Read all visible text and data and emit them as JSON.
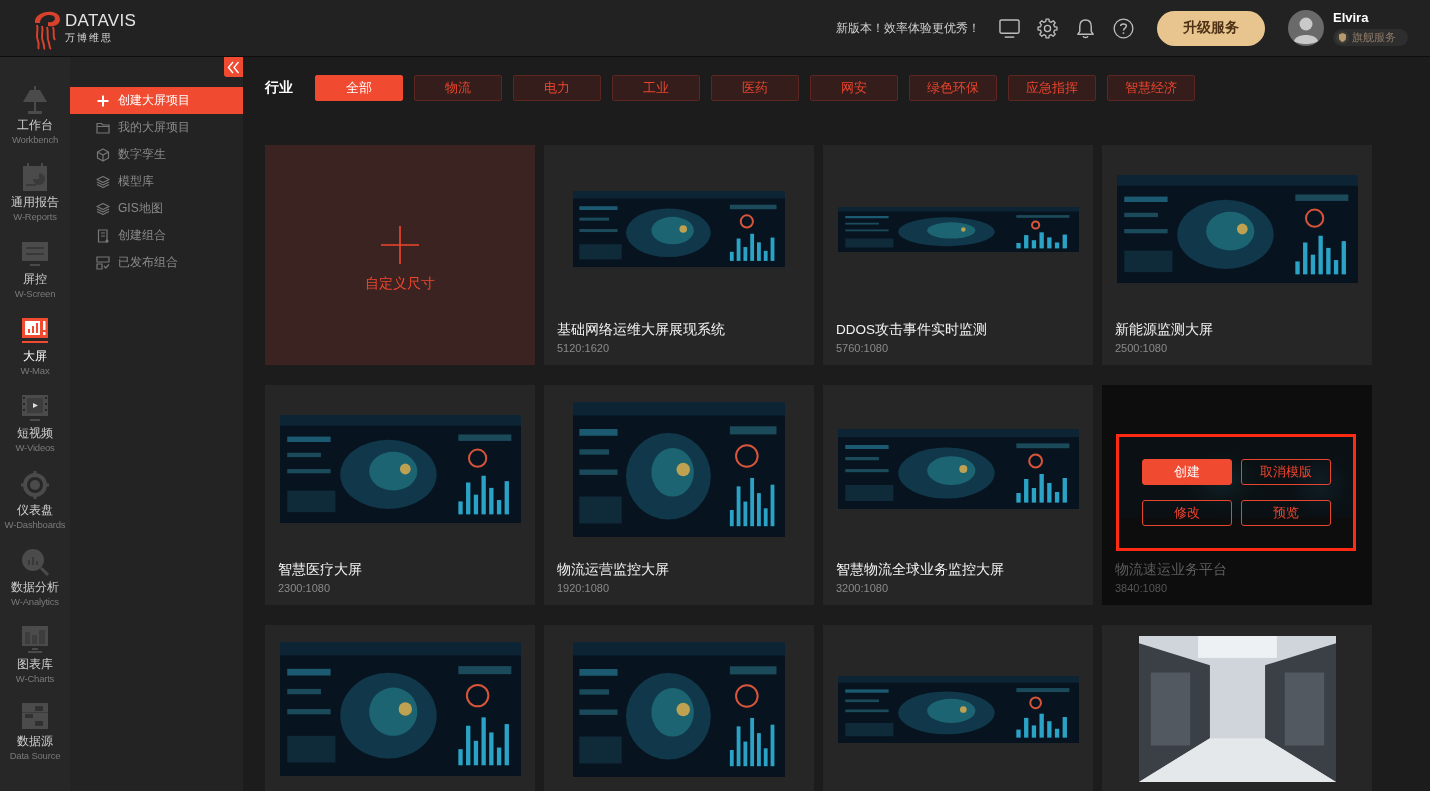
{
  "header": {
    "logo": {
      "name": "DATAVIS",
      "subtitle": "万博维思"
    },
    "notice": "新版本！效率体验更优秀！",
    "upgrade_button": "升级服务",
    "user": {
      "name": "Elvira",
      "badge": "旗舰服务"
    }
  },
  "nav_rail": {
    "items": [
      {
        "label": "工作台",
        "sublabel": "Workbench",
        "selected": false
      },
      {
        "label": "通用报告",
        "sublabel": "W-Reports",
        "selected": false
      },
      {
        "label": "屏控",
        "sublabel": "W-Screen",
        "selected": false
      },
      {
        "label": "大屏",
        "sublabel": "W-Max",
        "selected": true
      },
      {
        "label": "短视频",
        "sublabel": "W-Videos",
        "selected": false
      },
      {
        "label": "仪表盘",
        "sublabel": "W-Dashboards",
        "selected": false
      },
      {
        "label": "数据分析",
        "sublabel": "W-Analytics",
        "selected": false
      },
      {
        "label": "图表库",
        "sublabel": "W-Charts",
        "selected": false
      },
      {
        "label": "数据源",
        "sublabel": "Data Source",
        "selected": false
      }
    ]
  },
  "sidebar": {
    "items": [
      {
        "label": "创建大屏项目",
        "selected": true
      },
      {
        "label": "我的大屏项目",
        "selected": false
      },
      {
        "label": "数字孪生",
        "selected": false
      },
      {
        "label": "模型库",
        "selected": false
      },
      {
        "label": "GIS地图",
        "selected": false
      },
      {
        "label": "创建组合",
        "selected": false
      },
      {
        "label": "已发布组合",
        "selected": false
      }
    ]
  },
  "filter": {
    "label": "行业",
    "tabs": [
      {
        "label": "全部",
        "selected": true
      },
      {
        "label": "物流",
        "selected": false
      },
      {
        "label": "电力",
        "selected": false
      },
      {
        "label": "工业",
        "selected": false
      },
      {
        "label": "医药",
        "selected": false
      },
      {
        "label": "网安",
        "selected": false
      },
      {
        "label": "绿色环保",
        "selected": false
      },
      {
        "label": "应急指挥",
        "selected": false
      },
      {
        "label": "智慧经济",
        "selected": false
      }
    ]
  },
  "cards": [
    {
      "kind": "custom",
      "label": "自定义尺寸",
      "hovered": false
    },
    {
      "kind": "template",
      "title": "基础网络运维大屏展现系统",
      "size": "5120:1620",
      "preview": {
        "kind": "wide"
      },
      "hovered": false
    },
    {
      "kind": "template",
      "title": "DDOS攻击事件实时监测",
      "size": "5760:1080",
      "preview": {
        "kind": "strip"
      },
      "hovered": false
    },
    {
      "kind": "template",
      "title": "新能源监测大屏",
      "size": "2500:1080",
      "preview": {
        "kind": "standard"
      },
      "hovered": false
    },
    {
      "kind": "template",
      "title": "智慧医疗大屏",
      "size": "2300:1080",
      "preview": {
        "kind": "standard"
      },
      "hovered": false
    },
    {
      "kind": "template",
      "title": "物流运营监控大屏",
      "size": "1920:1080",
      "preview": {
        "kind": "compact"
      },
      "hovered": false
    },
    {
      "kind": "template",
      "title": "智慧物流全球业务监控大屏",
      "size": "3200:1080",
      "preview": {
        "kind": "banner"
      },
      "hovered": false
    },
    {
      "kind": "template",
      "title": "物流速运业务平台",
      "size": "3840:1080",
      "preview": {
        "kind": "banner"
      },
      "hovered": true,
      "actions": [
        {
          "label": "创建",
          "primary": true
        },
        {
          "label": "取消模版",
          "primary": false
        },
        {
          "label": "修改",
          "primary": false
        },
        {
          "label": "预览",
          "primary": false
        }
      ]
    },
    {
      "kind": "template",
      "preview": {
        "kind": "full"
      },
      "hovered": false
    },
    {
      "kind": "template",
      "preview": {
        "kind": "compact"
      },
      "hovered": false
    },
    {
      "kind": "template",
      "preview": {
        "kind": "low"
      },
      "hovered": false
    },
    {
      "kind": "template",
      "preview": {
        "kind": "photo"
      },
      "hovered": false
    }
  ]
}
